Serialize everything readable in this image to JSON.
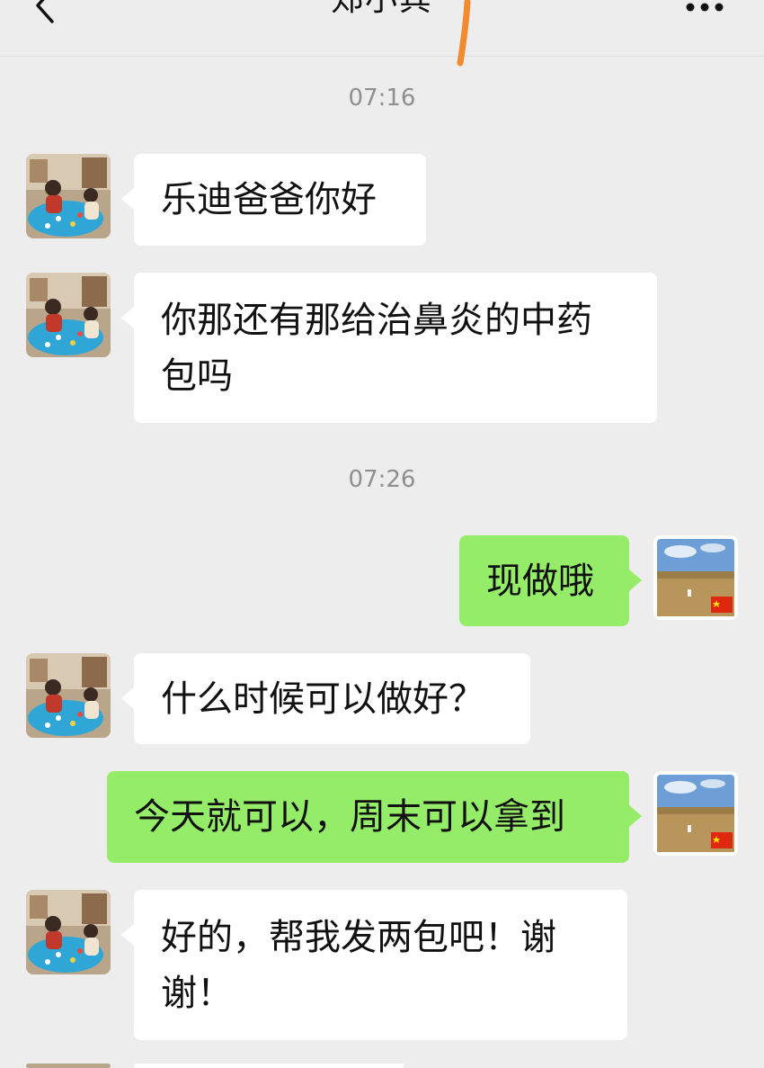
{
  "header": {
    "title": "郑小宾",
    "back_icon": "chevron-left-icon",
    "more_icon": "more-dots-icon"
  },
  "colors": {
    "background": "#ededed",
    "incoming_bubble": "#ffffff",
    "outgoing_bubble": "#95ec69",
    "timestamp_text": "#8f8f8f",
    "annotation": "#f28b30"
  },
  "timestamps": [
    "07:16",
    "07:26"
  ],
  "messages": [
    {
      "direction": "in",
      "text": "乐迪爸爸你好"
    },
    {
      "direction": "in",
      "text": "你那还有那给治鼻炎的中药",
      "text_line2": "包吗"
    },
    {
      "direction": "out",
      "text": "现做哦"
    },
    {
      "direction": "in",
      "text": "什么时候可以做好？"
    },
    {
      "direction": "out",
      "text": "今天就可以，周末可以拿到"
    },
    {
      "direction": "in",
      "text": "好的，帮我发两包吧！谢",
      "text_line2": "谢！"
    }
  ]
}
